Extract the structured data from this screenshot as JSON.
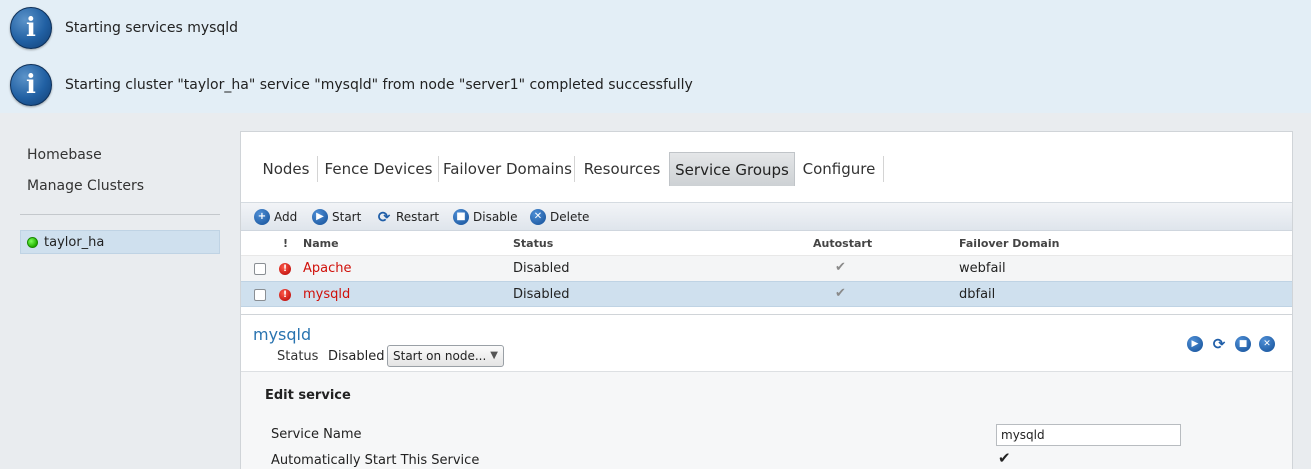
{
  "notices": [
    {
      "icon": "info-icon",
      "text": "Starting services mysqld"
    },
    {
      "icon": "info-icon",
      "text": "Starting cluster \"taylor_ha\" service \"mysqld\" from node \"server1\" completed successfully"
    }
  ],
  "nav": {
    "homebase": "Homebase",
    "manage_clusters": "Manage Clusters",
    "cluster": {
      "name": "taylor_ha",
      "status_color": "#22b100"
    }
  },
  "tabs": [
    "Nodes",
    "Fence Devices",
    "Failover Domains",
    "Resources",
    "Service Groups",
    "Configure"
  ],
  "active_tab": "Service Groups",
  "toolbar": {
    "add": "Add",
    "start": "Start",
    "restart": "Restart",
    "disable": "Disable",
    "delete": "Delete"
  },
  "grid": {
    "headers": {
      "warn": "!",
      "name": "Name",
      "status": "Status",
      "autostart": "Autostart",
      "domain": "Failover Domain"
    },
    "rows": [
      {
        "name": "Apache",
        "status": "Disabled",
        "autostart": "✔",
        "domain": "webfail"
      },
      {
        "name": "mysqld",
        "status": "Disabled",
        "autostart": "✔",
        "domain": "dbfail"
      }
    ]
  },
  "detail": {
    "title": "mysqld",
    "status_label": "Status",
    "status_value": "Disabled",
    "start_select": "Start on node...",
    "edit_heading": "Edit service",
    "service_name_label": "Service Name",
    "service_name_value": "mysqld",
    "autostart_label": "Automatically Start This Service",
    "autostart_check": "✔"
  },
  "colors": {
    "accent": "#2a74b0",
    "error_text": "#d0100a",
    "selected_row": "#cfe0ee"
  }
}
